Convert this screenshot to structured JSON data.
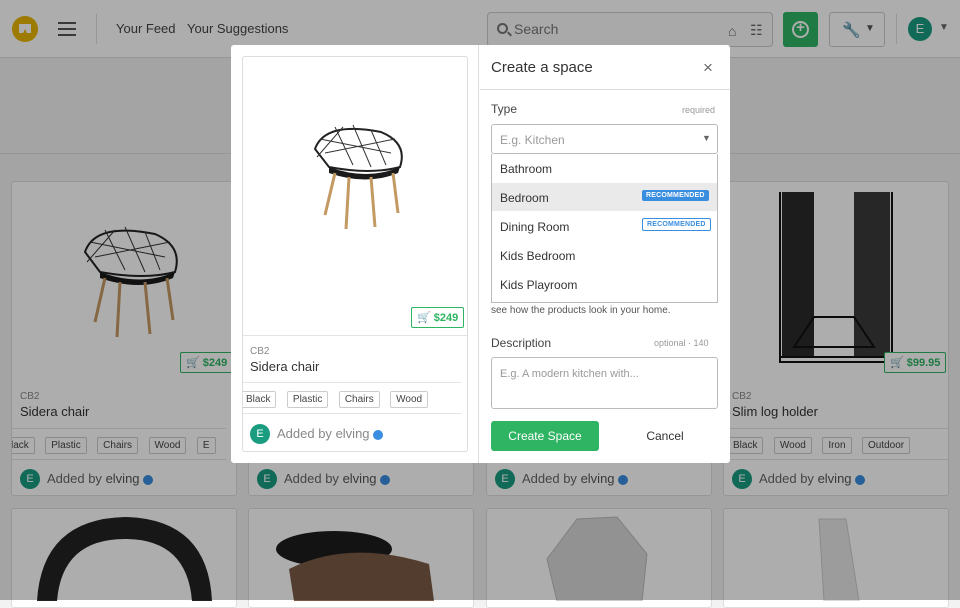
{
  "header": {
    "nav": [
      "Your Feed",
      "Your Suggestions"
    ],
    "search_placeholder": "Search",
    "avatar_initial": "E"
  },
  "cards": [
    {
      "brand": "CB2",
      "name": "Sidera chair",
      "price": "$249",
      "tags": [
        "lack",
        "Plastic",
        "Chairs",
        "Wood",
        "E"
      ],
      "added_prefix": "Added by",
      "added_user": "elving"
    },
    {
      "brand": "",
      "name": "",
      "price": "",
      "tags": [],
      "added_prefix": "Added by",
      "added_user": "elving"
    },
    {
      "brand": "",
      "name": "",
      "price": "",
      "tags": [],
      "added_prefix": "Added by",
      "added_user": "elving"
    },
    {
      "brand": "CB2",
      "name": "Slim log holder",
      "price": "$99.95",
      "tags": [
        "Black",
        "Wood",
        "Iron",
        "Outdoor"
      ],
      "added_prefix": "Added by",
      "added_user": "elving"
    }
  ],
  "modal": {
    "title": "Create a space",
    "close": "×",
    "product": {
      "brand": "CB2",
      "name": "Sidera chair",
      "price": "$249",
      "tags": [
        "Black",
        "Plastic",
        "Chairs",
        "Wood",
        ""
      ],
      "added_prefix": "Added by",
      "added_user": "elving"
    },
    "type_label": "Type",
    "type_hint": "required",
    "type_placeholder": "E.g. Kitchen",
    "options": [
      {
        "label": "Bathroom",
        "badge": ""
      },
      {
        "label": "Bedroom",
        "badge": "RECOMMENDED"
      },
      {
        "label": "Dining Room",
        "badge": "RECOMMENDED"
      },
      {
        "label": "Kids Bedroom",
        "badge": ""
      },
      {
        "label": "Kids Playroom",
        "badge": ""
      }
    ],
    "help_text": "see how the products look in your home.",
    "description_label": "Description",
    "description_hint": "optional · 140",
    "description_placeholder": "E.g. A modern kitchen with...",
    "create_button": "Create Space",
    "cancel_button": "Cancel"
  },
  "colors": {
    "accent": "#2eb463",
    "badge": "#3a8ee0",
    "logo": "#e8b400",
    "avatar": "#1a9c80"
  }
}
